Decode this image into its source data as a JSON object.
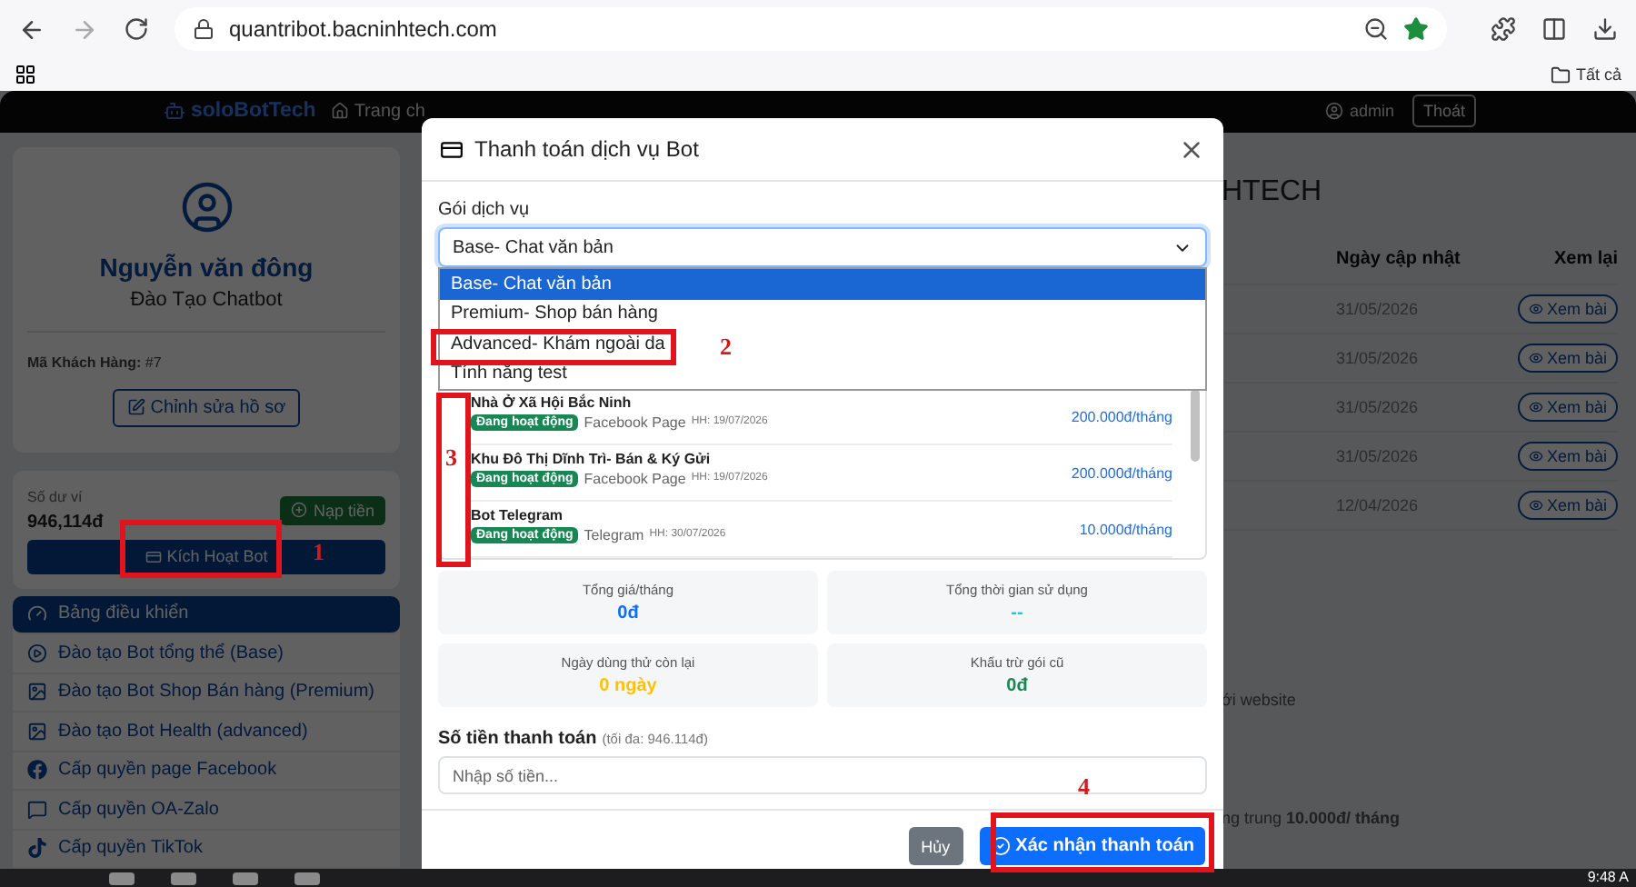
{
  "browser": {
    "url": "quantribot.bacninhtech.com",
    "bookmark_folder": "Tất cả"
  },
  "header": {
    "logo": "soloBot**Tech**",
    "nav_item": "Trang ch",
    "user": "admin",
    "logout": "Thoát"
  },
  "profile": {
    "name": "Nguyễn văn đông",
    "role": "Đào Tạo Chatbot",
    "customer_id": "**Mã Khách Hàng:** #7",
    "edit_button": "Chỉnh sửa hồ sơ"
  },
  "wallet": {
    "label": "Số dư ví",
    "balance": "946,114đ",
    "topup_button": "Nạp tiền",
    "activate_button": "Kích Hoạt Bot"
  },
  "menu": [
    {
      "label": "Bảng điều khiển",
      "selected": true
    },
    {
      "label": "Đào tạo Bot tổng thể (Base)",
      "selected": false
    },
    {
      "label": "Đào tạo Bot Shop Bán hàng (Premium)",
      "selected": false
    },
    {
      "label": "Đào tạo Bot Health (advanced)",
      "selected": false
    },
    {
      "label": "Cấp quyền page Facebook",
      "selected": false
    },
    {
      "label": "Cấp quyền OA-Zalo",
      "selected": false
    },
    {
      "label": "Cấp quyền TikTok",
      "selected": false
    }
  ],
  "content": {
    "heading": "HTECH",
    "columns": [
      "Ngày cập nhật",
      "Xem lại"
    ],
    "rows": [
      {
        "date": "31/05/2026",
        "action": "Xem bài"
      },
      {
        "date": "31/05/2026",
        "action": "Xem bài"
      },
      {
        "date": "31/05/2026",
        "action": "Xem bài"
      },
      {
        "date": "31/05/2026",
        "action": "Xem bài"
      },
      {
        "date": "12/04/2026",
        "action": "Xem bài"
      }
    ],
    "notes": [
      "ới website",
      "ng trung **10.000đ/ tháng**"
    ]
  },
  "modal": {
    "title": "Thanh toán dịch vụ Bot",
    "package_label": "Gói dịch vụ",
    "package_value": "Base- Chat văn bản",
    "options": [
      {
        "label": "Base- Chat văn bản",
        "selected": true
      },
      {
        "label": "Premium- Shop bán hàng",
        "selected": false
      },
      {
        "label": "Advanced- Khám ngoài da",
        "selected": false
      },
      {
        "label": "Tính năng test",
        "selected": false
      }
    ],
    "bots": [
      {
        "name": "Nhà Ở Xã Hội Bắc Ninh",
        "status": "Đang hoạt động",
        "platform": "Facebook Page",
        "expiry": "HH: 19/07/2026",
        "price": "200.000đ/tháng"
      },
      {
        "name": "Khu Đô Thị Dĩnh Trì- Bán & Ký Gửi",
        "status": "Đang hoạt động",
        "platform": "Facebook Page",
        "expiry": "HH: 19/07/2026",
        "price": "200.000đ/tháng"
      },
      {
        "name": "Bot Telegram",
        "status": "Đang hoạt động",
        "platform": "Telegram",
        "expiry": "HH: 30/07/2026",
        "price": "10.000đ/tháng"
      }
    ],
    "stats": [
      {
        "label": "Tổng giá/tháng",
        "value": "0đ",
        "color": "#0d6efd"
      },
      {
        "label": "Tổng thời gian sử dụng",
        "value": "--",
        "color": "#0dcaf0"
      },
      {
        "label": "Ngày dùng thử còn lại",
        "value": "0 ngày",
        "color": "#ffc107"
      },
      {
        "label": "Khấu trừ gói cũ",
        "value": "0đ",
        "color": "#198754"
      }
    ],
    "amount_label": "Số tiền thanh toán",
    "amount_hint": "(tối đa: 946.114đ)",
    "amount_placeholder": "Nhập số tiền...",
    "cancel": "Hủy",
    "confirm": "Xác nhận thanh toán"
  },
  "annotations": [
    {
      "number": "1"
    },
    {
      "number": "2"
    },
    {
      "number": "3"
    },
    {
      "number": "4"
    }
  ],
  "taskbar": {
    "time": "9:48 A"
  }
}
